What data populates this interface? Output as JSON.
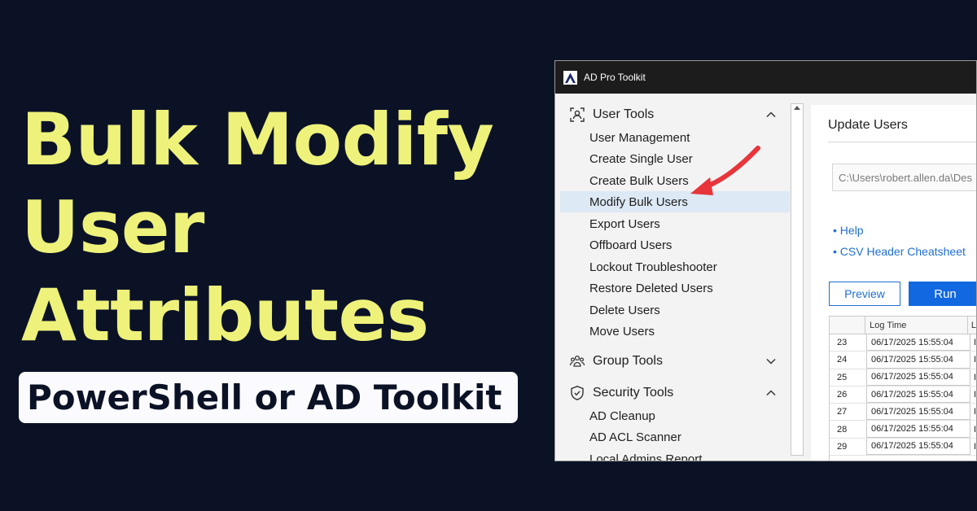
{
  "headline": {
    "line1": "Bulk Modify",
    "line2": "User",
    "line3": "Attributes"
  },
  "subtitle": "PowerShell or AD Toolkit",
  "colors": {
    "background": "#0b1226",
    "headline": "#eef27a",
    "annotation_arrow": "#e8343b",
    "accent": "#1168e0",
    "selected_row": "#dde9f5"
  },
  "app": {
    "title": "AD Pro Toolkit",
    "logo_icon": "triangle-logo-icon",
    "sidebar": {
      "sections": [
        {
          "label": "User Tools",
          "icon": "user-frame-icon",
          "chevron": "chevron-up-icon",
          "items": [
            "User Management",
            "Create Single User",
            "Create Bulk Users",
            "Modify Bulk Users",
            "Export Users",
            "Offboard Users",
            "Lockout Troubleshooter",
            "Restore Deleted Users",
            "Delete Users",
            "Move Users"
          ]
        },
        {
          "label": "Group Tools",
          "icon": "group-icon",
          "chevron": "chevron-down-icon",
          "items": []
        },
        {
          "label": "Security Tools",
          "icon": "shield-check-icon",
          "chevron": "chevron-up-icon",
          "items": [
            "AD Cleanup",
            "AD ACL Scanner",
            "Local Admins Report"
          ]
        }
      ],
      "selected_item": "Modify Bulk Users"
    },
    "content": {
      "title": "Update Users",
      "file_path": "C:\\Users\\robert.allen.da\\Des",
      "links": {
        "help": "• Help",
        "csv": "• CSV Header Cheatsheet"
      },
      "buttons": {
        "preview": "Preview",
        "run": "Run"
      },
      "log": {
        "column_log_time": "Log Time",
        "column_next": "L",
        "rows": [
          {
            "num": "23",
            "time": "06/17/2025 15:55:04",
            "next": "I"
          },
          {
            "num": "24",
            "time": "06/17/2025 15:55:04",
            "next": "I"
          },
          {
            "num": "25",
            "time": "06/17/2025 15:55:04",
            "next": "I"
          },
          {
            "num": "26",
            "time": "06/17/2025 15:55:04",
            "next": "I"
          },
          {
            "num": "27",
            "time": "06/17/2025 15:55:04",
            "next": "I"
          },
          {
            "num": "28",
            "time": "06/17/2025 15:55:04",
            "next": "I"
          },
          {
            "num": "29",
            "time": "06/17/2025 15:55:04",
            "next": "I"
          }
        ]
      }
    }
  }
}
